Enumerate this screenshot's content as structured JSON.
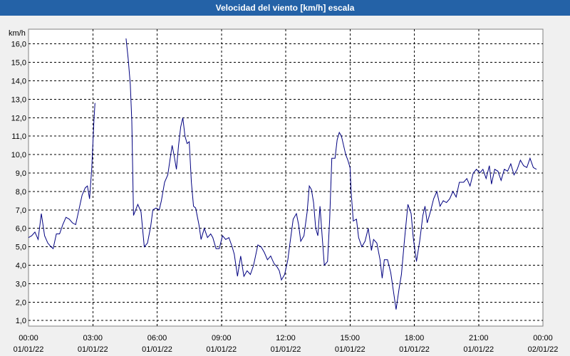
{
  "window": {
    "title": "Velocidad del viento [km/h] escala"
  },
  "chart_data": {
    "type": "line",
    "title": "Velocidad del viento [km/h] escala",
    "ylabel": "km/h",
    "xlabel": "",
    "ylim": [
      0.7,
      16.8
    ],
    "xlim": [
      0,
      24
    ],
    "grid": true,
    "colors": {
      "line": "#000080",
      "grid": "#000000",
      "background": "#ffffff"
    },
    "yticks": [
      "1,0",
      "2,0",
      "3,0",
      "4,0",
      "5,0",
      "6,0",
      "7,0",
      "8,0",
      "9,0",
      "10,0",
      "11,0",
      "12,0",
      "13,0",
      "14,0",
      "15,0",
      "16,0"
    ],
    "xticks": [
      {
        "hours": 0,
        "time": "00:00",
        "date": "01/01/22"
      },
      {
        "hours": 3,
        "time": "03:00",
        "date": "01/01/22"
      },
      {
        "hours": 6,
        "time": "06:00",
        "date": "01/01/22"
      },
      {
        "hours": 9,
        "time": "09:00",
        "date": "01/01/22"
      },
      {
        "hours": 12,
        "time": "12:00",
        "date": "01/01/22"
      },
      {
        "hours": 15,
        "time": "15:00",
        "date": "01/01/22"
      },
      {
        "hours": 18,
        "time": "18:00",
        "date": "01/01/22"
      },
      {
        "hours": 21,
        "time": "21:00",
        "date": "01/01/22"
      },
      {
        "hours": 24,
        "time": "00:00",
        "date": "02/01/22"
      }
    ],
    "series": [
      {
        "segments": [
          [
            [
              0.0,
              5.5
            ],
            [
              0.15,
              5.6
            ],
            [
              0.3,
              5.8
            ],
            [
              0.45,
              5.4
            ],
            [
              0.6,
              6.8
            ],
            [
              0.75,
              5.6
            ],
            [
              0.9,
              5.2
            ],
            [
              1.05,
              5.0
            ],
            [
              1.15,
              4.9
            ],
            [
              1.3,
              5.7
            ],
            [
              1.45,
              5.7
            ],
            [
              1.6,
              6.2
            ],
            [
              1.75,
              6.6
            ],
            [
              1.9,
              6.5
            ],
            [
              2.05,
              6.3
            ],
            [
              2.2,
              6.2
            ],
            [
              2.35,
              7.0
            ],
            [
              2.5,
              7.8
            ],
            [
              2.65,
              8.2
            ],
            [
              2.75,
              8.3
            ],
            [
              2.85,
              7.6
            ],
            [
              2.95,
              9.2
            ],
            [
              3.05,
              11.8
            ],
            [
              3.1,
              12.8
            ]
          ],
          [
            [
              4.55,
              16.3
            ],
            [
              4.65,
              15.2
            ],
            [
              4.75,
              13.8
            ],
            [
              4.82,
              11.8
            ],
            [
              4.9,
              6.7
            ],
            [
              5.0,
              7.0
            ],
            [
              5.1,
              7.3
            ],
            [
              5.25,
              6.9
            ],
            [
              5.4,
              5.0
            ],
            [
              5.55,
              5.2
            ],
            [
              5.7,
              6.1
            ],
            [
              5.8,
              7.0
            ],
            [
              5.95,
              7.1
            ],
            [
              6.1,
              7.0
            ],
            [
              6.2,
              7.5
            ],
            [
              6.35,
              8.5
            ],
            [
              6.5,
              8.9
            ],
            [
              6.6,
              9.7
            ],
            [
              6.7,
              10.5
            ],
            [
              6.8,
              9.9
            ],
            [
              6.9,
              9.2
            ],
            [
              7.0,
              10.5
            ],
            [
              7.1,
              11.5
            ],
            [
              7.2,
              12.0
            ],
            [
              7.3,
              11.0
            ],
            [
              7.4,
              10.6
            ],
            [
              7.5,
              10.7
            ],
            [
              7.6,
              8.5
            ],
            [
              7.7,
              7.2
            ],
            [
              7.8,
              7.1
            ],
            [
              7.95,
              6.2
            ],
            [
              8.05,
              5.4
            ],
            [
              8.2,
              6.0
            ],
            [
              8.35,
              5.5
            ],
            [
              8.5,
              5.7
            ],
            [
              8.6,
              5.5
            ],
            [
              8.75,
              4.9
            ],
            [
              8.9,
              4.9
            ],
            [
              9.05,
              5.6
            ],
            [
              9.2,
              5.4
            ],
            [
              9.35,
              5.5
            ],
            [
              9.5,
              5.0
            ],
            [
              9.6,
              4.6
            ],
            [
              9.75,
              3.4
            ],
            [
              9.9,
              4.5
            ],
            [
              10.05,
              3.4
            ],
            [
              10.2,
              3.7
            ],
            [
              10.35,
              3.5
            ],
            [
              10.5,
              4.0
            ],
            [
              10.7,
              5.1
            ],
            [
              10.85,
              5.0
            ],
            [
              11.0,
              4.7
            ],
            [
              11.15,
              4.3
            ],
            [
              11.3,
              4.5
            ],
            [
              11.45,
              4.1
            ],
            [
              11.6,
              3.9
            ],
            [
              11.7,
              3.7
            ],
            [
              11.8,
              3.2
            ],
            [
              11.95,
              3.5
            ],
            [
              12.1,
              4.3
            ],
            [
              12.2,
              5.2
            ],
            [
              12.35,
              6.5
            ],
            [
              12.5,
              6.8
            ],
            [
              12.6,
              6.2
            ],
            [
              12.7,
              5.3
            ],
            [
              12.85,
              5.6
            ],
            [
              13.0,
              6.9
            ],
            [
              13.1,
              8.3
            ],
            [
              13.2,
              8.1
            ],
            [
              13.3,
              7.4
            ],
            [
              13.4,
              6.0
            ],
            [
              13.5,
              5.6
            ],
            [
              13.6,
              7.2
            ],
            [
              13.7,
              5.6
            ],
            [
              13.8,
              4.0
            ],
            [
              13.95,
              4.2
            ],
            [
              14.05,
              6.5
            ],
            [
              14.15,
              9.8
            ],
            [
              14.3,
              9.8
            ],
            [
              14.4,
              10.8
            ],
            [
              14.5,
              11.2
            ],
            [
              14.6,
              11.0
            ],
            [
              14.7,
              10.5
            ],
            [
              14.8,
              10.0
            ],
            [
              14.9,
              9.7
            ],
            [
              15.0,
              9.3
            ],
            [
              15.05,
              8.0
            ],
            [
              15.15,
              6.4
            ],
            [
              15.3,
              6.5
            ],
            [
              15.4,
              5.5
            ],
            [
              15.55,
              5.0
            ],
            [
              15.7,
              5.3
            ],
            [
              15.85,
              6.0
            ],
            [
              16.0,
              4.8
            ],
            [
              16.1,
              5.4
            ],
            [
              16.25,
              5.2
            ],
            [
              16.4,
              4.3
            ],
            [
              16.5,
              3.3
            ],
            [
              16.6,
              4.3
            ],
            [
              16.75,
              4.3
            ],
            [
              16.9,
              3.6
            ],
            [
              17.0,
              2.8
            ],
            [
              17.15,
              1.6
            ],
            [
              17.3,
              2.8
            ],
            [
              17.4,
              3.5
            ],
            [
              17.55,
              5.5
            ],
            [
              17.7,
              7.3
            ],
            [
              17.85,
              6.8
            ],
            [
              17.95,
              5.5
            ],
            [
              18.1,
              4.2
            ],
            [
              18.25,
              5.3
            ],
            [
              18.4,
              6.7
            ],
            [
              18.5,
              7.2
            ],
            [
              18.6,
              6.3
            ],
            [
              18.75,
              6.9
            ],
            [
              18.9,
              7.6
            ],
            [
              19.05,
              8.0
            ],
            [
              19.2,
              7.2
            ],
            [
              19.35,
              7.5
            ],
            [
              19.5,
              7.4
            ],
            [
              19.65,
              7.6
            ],
            [
              19.8,
              8.0
            ],
            [
              19.95,
              7.7
            ],
            [
              20.1,
              8.5
            ],
            [
              20.3,
              8.5
            ],
            [
              20.45,
              8.7
            ],
            [
              20.6,
              8.3
            ],
            [
              20.75,
              9.0
            ],
            [
              20.9,
              9.2
            ],
            [
              21.05,
              9.0
            ],
            [
              21.2,
              9.2
            ],
            [
              21.35,
              8.7
            ],
            [
              21.5,
              9.4
            ],
            [
              21.6,
              8.4
            ],
            [
              21.75,
              9.2
            ],
            [
              21.9,
              9.1
            ],
            [
              22.05,
              8.6
            ],
            [
              22.2,
              9.2
            ],
            [
              22.35,
              9.1
            ],
            [
              22.5,
              9.5
            ],
            [
              22.65,
              8.9
            ],
            [
              22.8,
              9.2
            ],
            [
              22.95,
              9.7
            ],
            [
              23.1,
              9.4
            ],
            [
              23.25,
              9.3
            ],
            [
              23.4,
              9.8
            ],
            [
              23.55,
              9.3
            ],
            [
              23.7,
              9.2
            ]
          ]
        ]
      }
    ]
  }
}
